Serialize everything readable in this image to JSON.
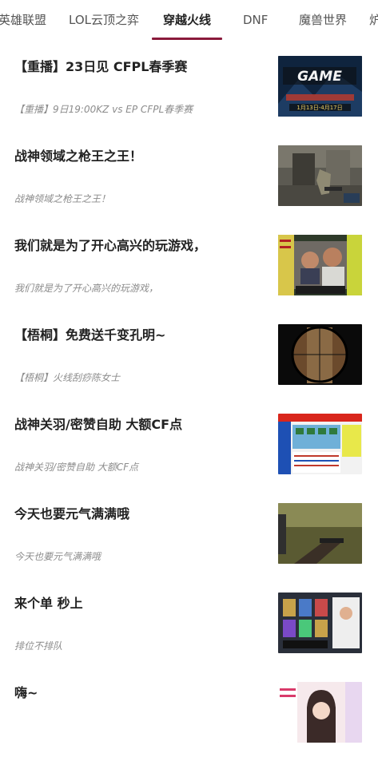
{
  "tabs": [
    {
      "label": "英雄联盟",
      "active": false
    },
    {
      "label": "LOL云顶之弈",
      "active": false
    },
    {
      "label": "穿越火线",
      "active": true
    },
    {
      "label": "DNF",
      "active": false
    },
    {
      "label": "魔兽世界",
      "active": false
    },
    {
      "label": "炉",
      "active": false
    }
  ],
  "colors": {
    "accent": "#8a1a3b",
    "title": "#222222",
    "subtitle": "#8c8c8c",
    "divider": "#eeeeee"
  },
  "feed": [
    {
      "title": "【重播】23日见 CFPL春季赛",
      "subtitle": "【重播】9日19:00KZ vs EP CFPL春季赛",
      "thumb": "cfpl-banner",
      "thumb_text": "1月13日-4月17日"
    },
    {
      "title": "战神领域之枪王之王！",
      "subtitle": "战神领域之枪王之王！",
      "thumb": "fps-corridor"
    },
    {
      "title": "我们就是为了开心高兴的玩游戏，",
      "subtitle": "我们就是为了开心高兴的玩游戏，",
      "thumb": "webcam-streamers"
    },
    {
      "title": "【梧桐】免费送千变孔明~",
      "subtitle": "【梧桐】火线刮痧陈女士",
      "thumb": "sniper-scope"
    },
    {
      "title": "战神关羽/密赞自助 大额CF点",
      "subtitle": "战神关羽/密赞自助 大额CF点",
      "thumb": "chart-screen"
    },
    {
      "title": "今天也要元气满满哦",
      "subtitle": "今天也要元气满满哦",
      "thumb": "fps-gun"
    },
    {
      "title": "来个单 秒上",
      "subtitle": "排位不排队",
      "thumb": "inventory-screen"
    },
    {
      "title": "嗨~",
      "subtitle": "",
      "thumb": "streamer-girl"
    }
  ]
}
